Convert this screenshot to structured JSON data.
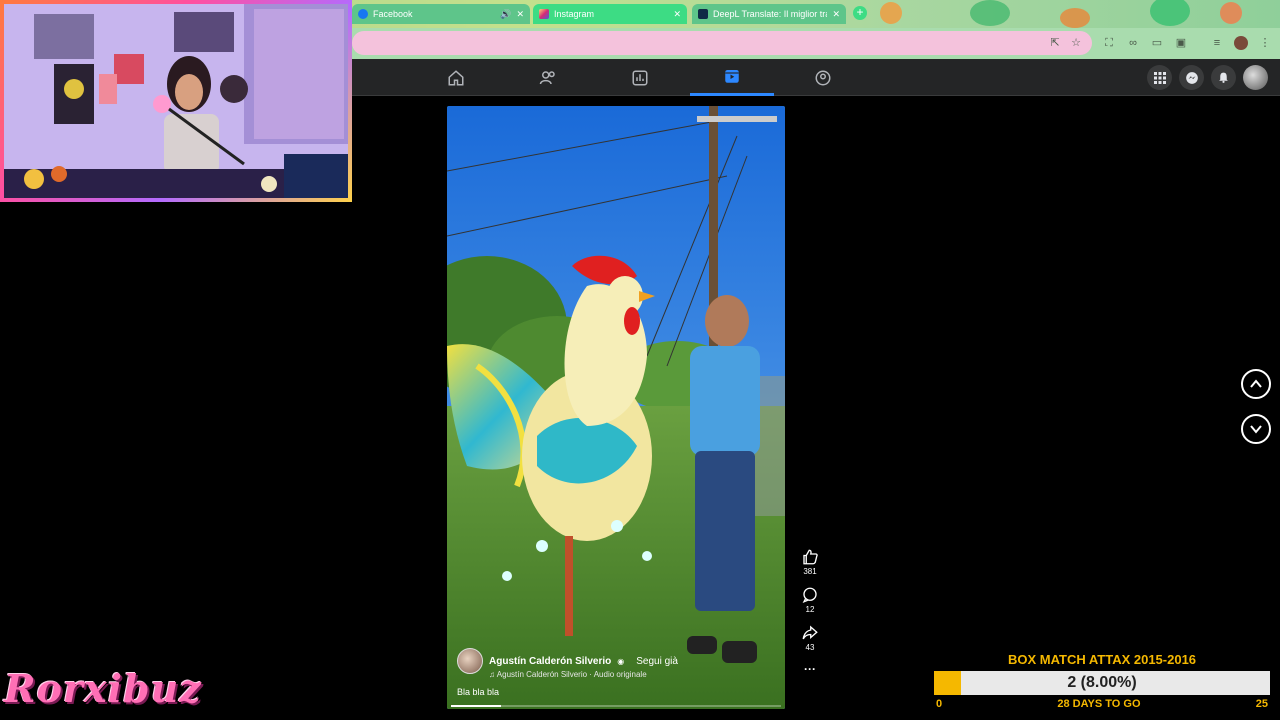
{
  "tabs": [
    {
      "label": "Facebook",
      "icon": "facebook-icon",
      "color": "#1877f2"
    },
    {
      "label": "Instagram",
      "icon": "instagram-icon",
      "color": "#e1306c"
    },
    {
      "label": "DeepL Translate: Il miglior tra",
      "icon": "deepl-icon",
      "color": "#0f2b46"
    }
  ],
  "new_tab_label": "+",
  "reel": {
    "author": "Agustín Calderón Silverio",
    "follow_label": "Segui già",
    "audio": "Agustín Calderón Silverio · Audio originale",
    "caption": "Bla bla bla",
    "likes": "381",
    "comments": "12",
    "shares": "43",
    "more_label": "···",
    "progress": 0.15
  },
  "overlay": {
    "brand": "Rorxibuz",
    "goal_title": "BOX MATCH ATTAX 2015-2016",
    "goal_value": "2 (8.00%)",
    "goal_progress": 0.08,
    "goal_min": "0",
    "goal_days": "28 DAYS TO GO",
    "goal_max": "25"
  },
  "colors": {
    "accent": "#2d88ff",
    "gold": "#f5b800",
    "pink": "#ff6fb5"
  }
}
